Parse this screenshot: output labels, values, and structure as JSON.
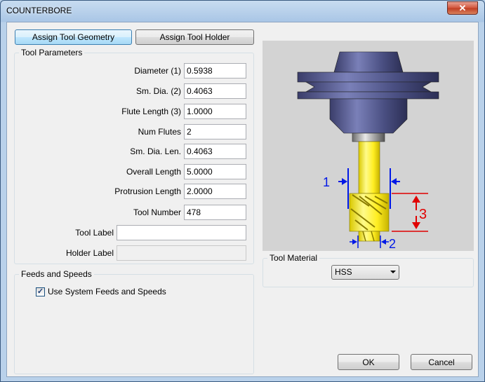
{
  "window": {
    "title": "COUNTERBORE",
    "close_glyph": "✕"
  },
  "tabs": {
    "assign_geometry": "Assign Tool Geometry",
    "assign_holder": "Assign Tool Holder"
  },
  "tool_parameters": {
    "title": "Tool Parameters",
    "diameter": {
      "label": "Diameter (1)",
      "value": "0.5938"
    },
    "sm_dia": {
      "label": "Sm. Dia. (2)",
      "value": "0.4063"
    },
    "flute_length": {
      "label": "Flute Length (3)",
      "value": "1.0000"
    },
    "num_flutes": {
      "label": "Num Flutes",
      "value": "2"
    },
    "sm_dia_len": {
      "label": "Sm. Dia. Len.",
      "value": "0.4063"
    },
    "overall_length": {
      "label": "Overall Length",
      "value": "5.0000"
    },
    "protrusion_length": {
      "label": "Protrusion Length",
      "value": "2.0000"
    },
    "tool_number": {
      "label": "Tool Number",
      "value": "478"
    },
    "tool_label": {
      "label": "Tool Label",
      "value": ""
    },
    "holder_label": {
      "label": "Holder Label",
      "value": ""
    }
  },
  "feeds": {
    "title": "Feeds and Speeds",
    "use_system_label": "Use System Feeds and Speeds",
    "use_system_checked": true,
    "check_glyph": "✓"
  },
  "diagram": {
    "label1": "1",
    "label2": "2",
    "label3": "3"
  },
  "material": {
    "title": "Tool Material",
    "selected": "HSS"
  },
  "buttons": {
    "ok": "OK",
    "cancel": "Cancel"
  },
  "colors": {
    "dimension_blue": "#0018e6",
    "dimension_red": "#e00000",
    "tool_yellow": "#ffee22",
    "holder_purple": "#4a4f82"
  }
}
